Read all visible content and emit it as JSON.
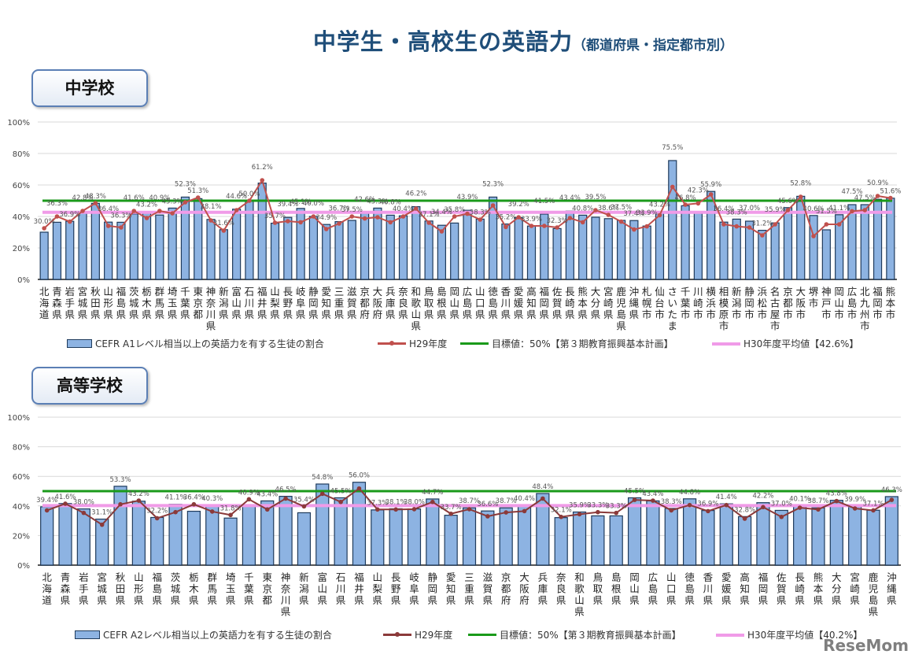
{
  "title": {
    "main": "中学生・高校生の英語力",
    "sub": "（都道府県・指定都市別）"
  },
  "watermark": "ReseMom",
  "chart_data": [
    {
      "section_label": "中学校",
      "type": "bar",
      "ylim": [
        0,
        100
      ],
      "yticks": [
        "0%",
        "20%",
        "40%",
        "60%",
        "80%",
        "100%"
      ],
      "grid": true,
      "legend_placement": "bottom",
      "categories": [
        "北海道",
        "青森県",
        "岩手県",
        "宮城県",
        "秋田県",
        "山形県",
        "福島県",
        "茨城県",
        "栃木県",
        "群馬県",
        "埼玉県",
        "千葉県",
        "東京都",
        "神奈川県",
        "新潟県",
        "富山県",
        "石川県",
        "福井県",
        "山梨県",
        "長野県",
        "岐阜県",
        "静岡県",
        "愛知県",
        "三重県",
        "滋賀県",
        "京都府",
        "大阪府",
        "兵庫県",
        "奈良県",
        "和歌山県",
        "鳥取県",
        "島根県",
        "岡山県",
        "広島県",
        "山口県",
        "徳島県",
        "香川県",
        "愛媛県",
        "高知県",
        "福岡県",
        "佐賀県",
        "長崎県",
        "熊本県",
        "大分県",
        "宮崎県",
        "鹿児島県",
        "沖縄県",
        "札幌市",
        "仙台市",
        "さいたま",
        "千葉市",
        "川崎市",
        "横浜市",
        "相模原市",
        "新潟市",
        "静岡市",
        "浜松市",
        "名古屋市",
        "京都市",
        "大阪市",
        "堺市",
        "神戸市",
        "岡山市",
        "広島市",
        "北九州市",
        "福岡市",
        "熊本市"
      ],
      "series": [
        {
          "name": "CEFR A1レベル相当以上の英語力を有する生徒の割合",
          "type": "bar",
          "color": "#8db3e2",
          "values": [
            30.0,
            36.3,
            36.9,
            42.8,
            48.3,
            36.4,
            36.3,
            41.6,
            43.2,
            40.9,
            45.3,
            52.3,
            51.3,
            38.1,
            31.6,
            44.6,
            50.0,
            61.2,
            35.7,
            39.4,
            45.1,
            40.0,
            34.9,
            36.7,
            37.5,
            42.6,
            45.3,
            40.8,
            40.4,
            46.2,
            37.1,
            34.4,
            35.8,
            43.9,
            38.3,
            52.3,
            35.2,
            39.2,
            33.9,
            41.5,
            32.3,
            43.4,
            40.8,
            39.5,
            38.6,
            37.5,
            37.4,
            33.9,
            43.2,
            75.5,
            46.8,
            42.3,
            55.9,
            36.4,
            38.3,
            37.0,
            31.2,
            35.9,
            45.6,
            52.8,
            40.6,
            31.5,
            41.1,
            47.5,
            47.5,
            50.9,
            51.6
          ]
        },
        {
          "name": "H29年度",
          "type": "line",
          "color": "#c0504d",
          "values": [
            32.5,
            40,
            36.7,
            43.5,
            48.5,
            34,
            33,
            43.5,
            39,
            43.5,
            42,
            49,
            52,
            37.5,
            31,
            44,
            50,
            63,
            36,
            37,
            36.3,
            40,
            32,
            35.5,
            40,
            38.7,
            39.5,
            36.3,
            40,
            45,
            36,
            30.5,
            40,
            41.7,
            38,
            47,
            33.3,
            39.5,
            34,
            34,
            33,
            39,
            36.3,
            44,
            41,
            36.7,
            31.7,
            33.7,
            40.8,
            58.8,
            47.5,
            48.3,
            54,
            35,
            33.7,
            33,
            28,
            35,
            44,
            52.5,
            27.5,
            35,
            35,
            43.3,
            44,
            53,
            51.7
          ]
        },
        {
          "name": "目標値：50%【第３期教育振興基本計画】",
          "type": "hline",
          "color": "#1a9a1a",
          "value": 50
        },
        {
          "name": "H30年度平均値【42.6%】",
          "type": "hline",
          "color": "#f09be8",
          "value": 42.6
        }
      ]
    },
    {
      "section_label": "高等学校",
      "type": "bar",
      "ylim": [
        0,
        100
      ],
      "yticks": [
        "0%",
        "20%",
        "40%",
        "60%",
        "80%",
        "100%"
      ],
      "grid": true,
      "legend_placement": "bottom",
      "categories": [
        "北海道",
        "青森県",
        "岩手県",
        "宮城県",
        "秋田県",
        "山形県",
        "福島県",
        "茨城県",
        "栃木県",
        "群馬県",
        "埼玉県",
        "千葉県",
        "東京都",
        "神奈川県",
        "新潟県",
        "富山県",
        "石川県",
        "福井県",
        "山梨県",
        "長野県",
        "岐阜県",
        "静岡県",
        "愛知県",
        "三重県",
        "滋賀県",
        "京都府",
        "大阪府",
        "兵庫県",
        "奈良県",
        "和歌山県",
        "鳥取県",
        "島根県",
        "岡山県",
        "広島県",
        "山口県",
        "徳島県",
        "香川県",
        "愛媛県",
        "高知県",
        "福岡県",
        "佐賀県",
        "長崎県",
        "熊本県",
        "大分県",
        "宮崎県",
        "鹿児島県",
        "沖縄県"
      ],
      "series": [
        {
          "name": "CEFR A2レベル相当以上の英語力を有する生徒の割合",
          "type": "bar",
          "color": "#8db3e2",
          "values": [
            39.4,
            41.6,
            38.0,
            31.1,
            53.3,
            43.2,
            32.2,
            41.1,
            36.4,
            40.3,
            31.8,
            40.9,
            43.4,
            46.5,
            35.4,
            54.8,
            45.5,
            56.0,
            37.3,
            38.1,
            38.0,
            44.7,
            33.7,
            38.7,
            36.6,
            38.7,
            40.4,
            48.4,
            32.1,
            35.9,
            33.3,
            33.3,
            45.5,
            43.4,
            38.3,
            44.8,
            36.9,
            41.4,
            32.8,
            42.2,
            37.0,
            40.1,
            38.7,
            43.8,
            39.9,
            37.1,
            46.3
          ]
        },
        {
          "name": "H29年度",
          "type": "line",
          "color": "#8b3a3a",
          "values": [
            37,
            41.5,
            35.3,
            27.3,
            41.1,
            43.6,
            31.7,
            35.8,
            41.1,
            36.2,
            33.9,
            44.5,
            37.6,
            45,
            39.7,
            48.2,
            42.7,
            51.8,
            37.6,
            37.6,
            37.8,
            42.7,
            34.7,
            37.8,
            33,
            35.6,
            36.5,
            45,
            32.6,
            34.4,
            35.8,
            35.3,
            44.1,
            43.6,
            37,
            40.6,
            36.5,
            40.6,
            31.4,
            39.2,
            32.6,
            38.8,
            37.6,
            43.3,
            38.3,
            37,
            44.1
          ]
        },
        {
          "name": "目標値：50%【第３期教育振興基本計画】",
          "type": "hline",
          "color": "#1a9a1a",
          "value": 50
        },
        {
          "name": "H30年度平均値【40.2%】",
          "type": "hline",
          "color": "#f09be8",
          "value": 40.2
        }
      ]
    }
  ]
}
